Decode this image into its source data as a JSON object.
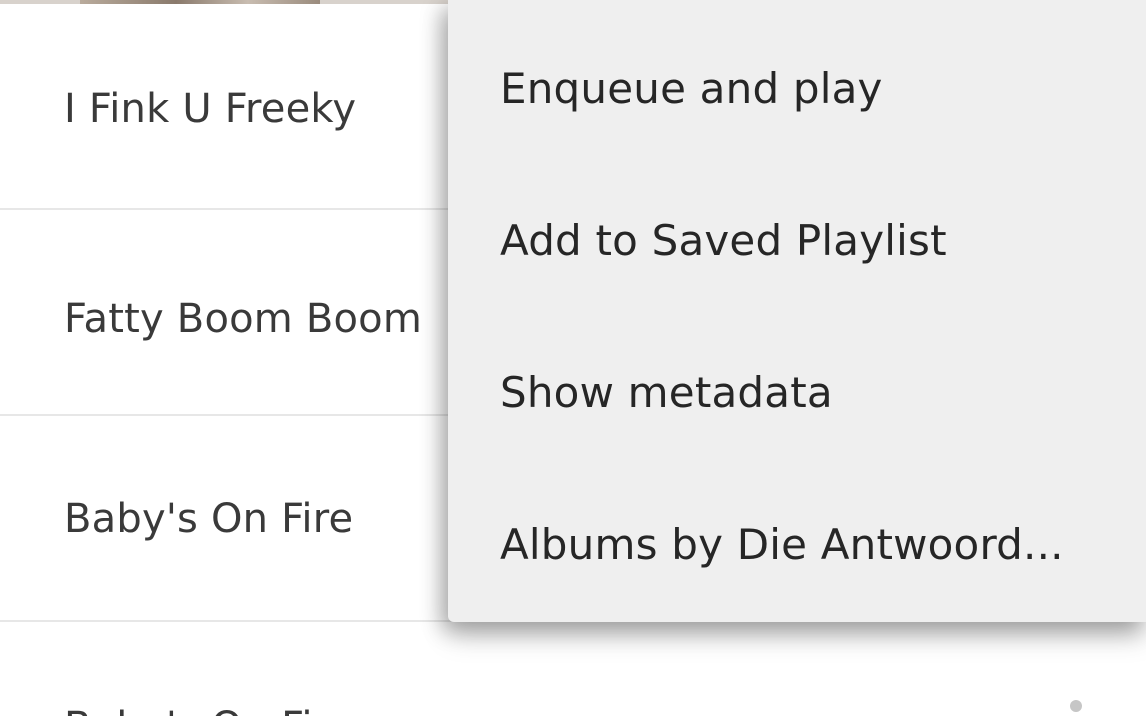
{
  "tracks": [
    {
      "title": "I Fink U Freeky"
    },
    {
      "title": "Fatty Boom Boom"
    },
    {
      "title": "Baby's On Fire"
    },
    {
      "title": "Baby's On Fire"
    }
  ],
  "context_menu": {
    "items": [
      {
        "label": "Enqueue and play"
      },
      {
        "label": "Add to Saved Playlist"
      },
      {
        "label": "Show metadata"
      },
      {
        "label": "Albums by Die Antwoord..."
      }
    ]
  },
  "icons": {
    "overflow": "more-vert-icon"
  },
  "colors": {
    "menu_background": "#efefef",
    "list_background": "#ffffff",
    "divider": "#e7e7e7",
    "text": "#3a3a3a"
  }
}
